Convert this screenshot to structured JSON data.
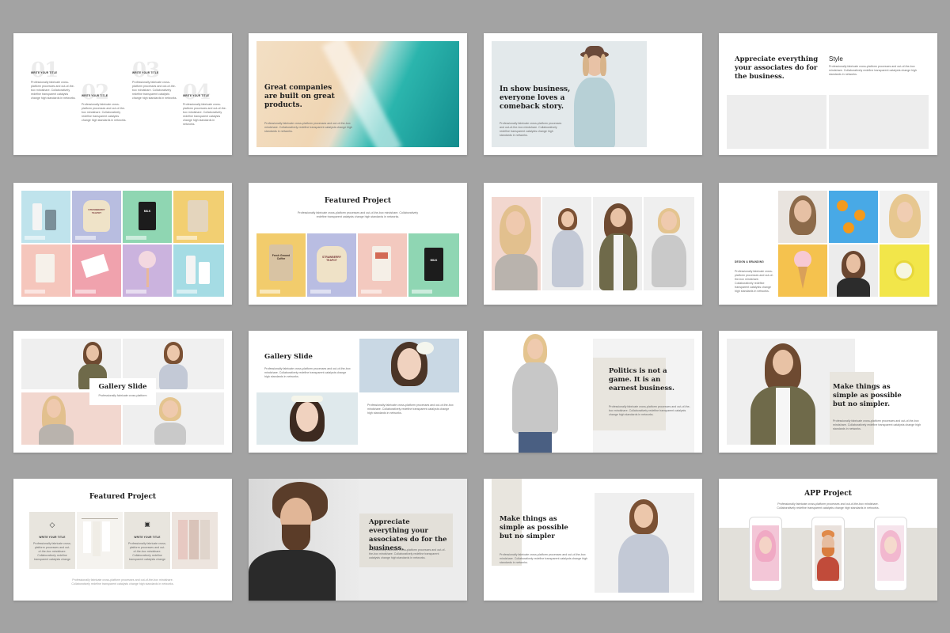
{
  "colors": {
    "background": "#a3a3a3",
    "slide": "#ffffff",
    "beige_panel": "#e8e5de",
    "grey_panel": "#ededed",
    "heading": "#1e1e1e",
    "body_text": "#6b6b6b"
  },
  "icons": [
    "diamond-icon",
    "chat-icon"
  ],
  "body_text": "Professionally fabricate cross-platform processes and out-of-the-box mindshare. Collaboratively redefine transparent catalysts change high standards in networks.",
  "slide1": {
    "items": [
      {
        "number": "01",
        "title": "WRITE YOUR TITLE"
      },
      {
        "number": "02",
        "title": "WRITE YOUR TITLE"
      },
      {
        "number": "03",
        "title": "WRITE YOUR TITLE"
      },
      {
        "number": "04",
        "title": "WRITE YOUR TITLE"
      }
    ]
  },
  "slide2": {
    "title": "Great companies are built on great products."
  },
  "slide3": {
    "title": "In show business, everyone loves a comeback story."
  },
  "slide4": {
    "title": "Appreciate everything your associates do for the business.",
    "label": "Style"
  },
  "slide6": {
    "title": "Featured Project"
  },
  "slide8": {
    "label": "DESIGN & BRANDING"
  },
  "slide9": {
    "title": "Gallery Slide"
  },
  "slide10": {
    "title": "Gallery Slide"
  },
  "slide11": {
    "title": "Politics is not a game. It is an earnest business."
  },
  "slide12": {
    "title": "Make things as simple as possible but no simpler."
  },
  "slide13": {
    "title": "Featured Project",
    "card_title": "WRITE YOUR TITLE"
  },
  "slide14": {
    "title": "Appreciate everything your associates do for the business."
  },
  "slide15": {
    "title": "Make things as simple as possible but no simpler"
  },
  "slide16": {
    "title": "APP Project"
  },
  "cards": {
    "pouch_text": "Fresh Ground Coffee",
    "jug_text": "STRAWBERRY TEAPOT",
    "bag_text": "MILK"
  }
}
